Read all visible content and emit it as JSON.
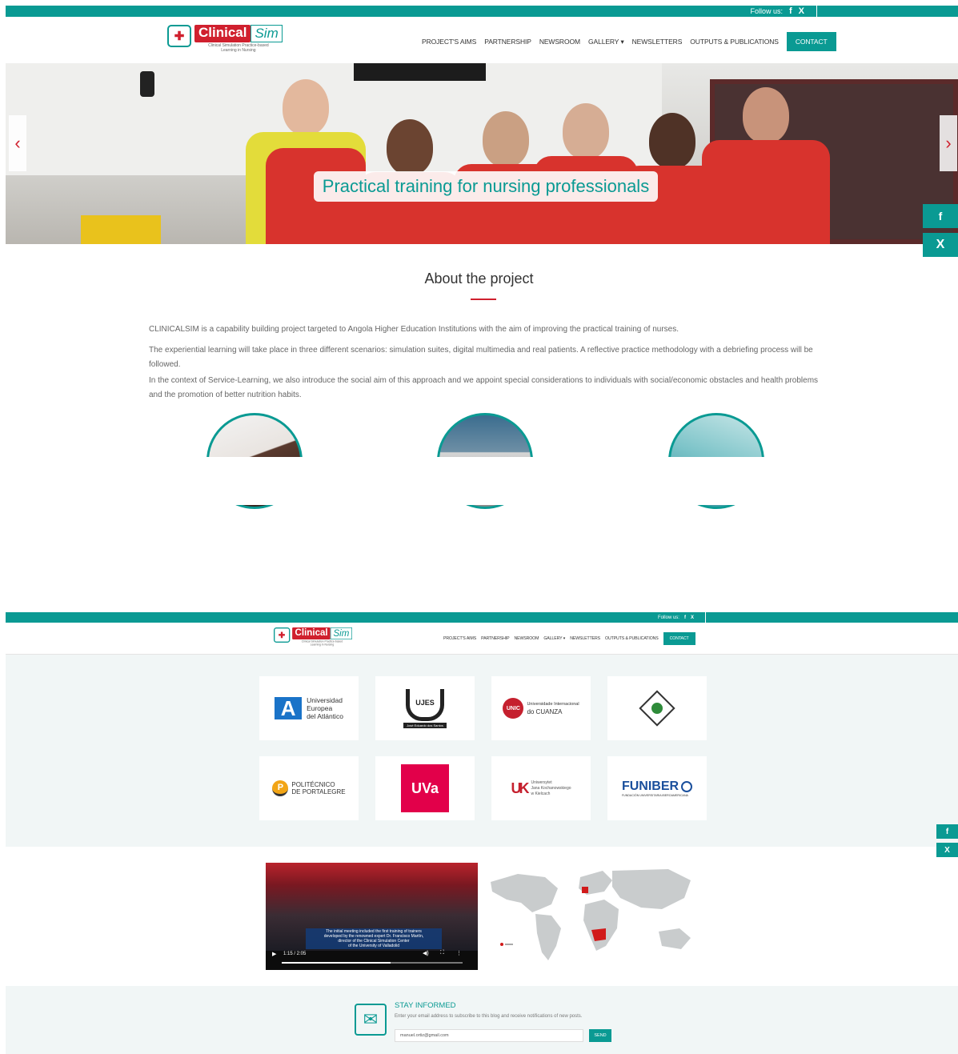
{
  "follow": {
    "label": "Follow us:",
    "facebook_glyph": "f",
    "x_glyph": "X"
  },
  "logo": {
    "clinical": "Clinical",
    "sim": "Sim",
    "subtitle_line1": "Clinical Simulation Practice-based",
    "subtitle_line2": "Learning in Nursing"
  },
  "nav": {
    "items": [
      "PROJECT'S AIMS",
      "PARTNERSHIP",
      "NEWSROOM",
      "GALLERY ▾",
      "NEWSLETTERS",
      "OUTPUTS & PUBLICATIONS"
    ],
    "contact": "CONTACT"
  },
  "hero": {
    "caption": "Practical training for nursing professionals",
    "prev": "‹",
    "next": "›"
  },
  "about": {
    "title": "About the project",
    "paragraphs": [
      "CLINICALSIM is a capability building project targeted to Angola Higher Education Institutions with the aim of improving the practical training of nurses.",
      "The experiential learning will take place in three different scenarios: simulation suites, digital multimedia and real patients. A reflective practice methodology with a debriefing process will be followed.",
      "In the context of Service-Learning, we also introduce the social aim of this approach and we appoint special considerations to individuals with social/economic obstacles and health problems and the promotion of better nutrition habits."
    ]
  },
  "partners": {
    "uea": {
      "line1": "Universidad",
      "line2": "Europea",
      "line3": "del Atlántico"
    },
    "ujes": {
      "name": "UJES",
      "sub": "José Eduardo dos Santos"
    },
    "unic": {
      "badge": "UNIC",
      "line1": "Universidade Internacional",
      "line2": "do CUANZA"
    },
    "portalegre": {
      "line1": "POLITÉCNICO",
      "line2": "DE PORTALEGRE"
    },
    "uva": {
      "name": "UVa"
    },
    "ujk": {
      "badge": "UK",
      "line1": "Uniwersytet",
      "line2": "Jana Kochanowskiego",
      "line3": "w Kielcach"
    },
    "funiber": {
      "name": "FUNIBER",
      "sub": "FUNDACIÓN UNIVERSITARIA IBEROAMERICANA"
    }
  },
  "video": {
    "subtitle_line1": "The initial meeting included the first training of trainers",
    "subtitle_line2": "developed by the renowned expert Dr. Francisco Martín,",
    "subtitle_line3": "director of the Clinical Simulation Center",
    "subtitle_line4": "of the University of Valladolid",
    "time": "1:15 / 2:05",
    "progress": 0.6
  },
  "newsletter": {
    "title": "STAY INFORMED",
    "text": "Enter your email address to subscribe to this blog and receive notifications of new posts.",
    "email_value": "manuel.ortiz@gmail.com",
    "send": "SEND"
  },
  "colors": {
    "teal": "#0a9a93",
    "red": "#d0202e"
  }
}
